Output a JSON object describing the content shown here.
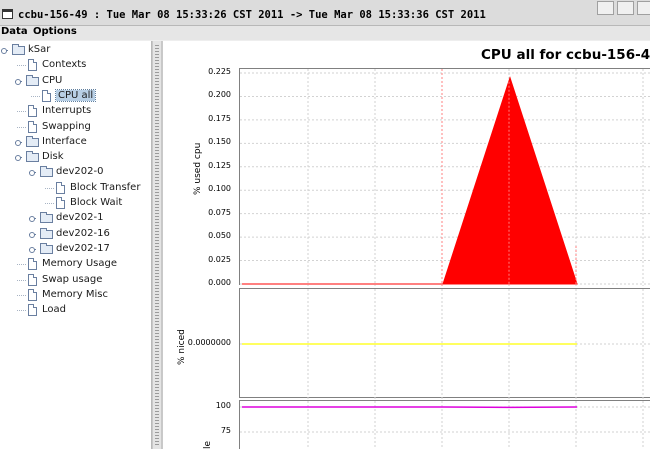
{
  "window": {
    "title": "ccbu-156-49 : Tue Mar 08 15:33:26 CST 2011 -> Tue Mar 08 15:33:36 CST 2011"
  },
  "menubar": {
    "items": [
      "Data",
      "Options"
    ]
  },
  "tree": {
    "nodes": [
      {
        "label": "kSar",
        "kind": "folder",
        "depth": 0,
        "expanded": true,
        "selected": false
      },
      {
        "label": "Contexts",
        "kind": "doc",
        "depth": 1,
        "selected": false
      },
      {
        "label": "CPU",
        "kind": "folder",
        "depth": 1,
        "expanded": true,
        "selected": false
      },
      {
        "label": "CPU all",
        "kind": "doc",
        "depth": 2,
        "selected": true
      },
      {
        "label": "Interrupts",
        "kind": "doc",
        "depth": 1,
        "selected": false
      },
      {
        "label": "Swapping",
        "kind": "doc",
        "depth": 1,
        "selected": false
      },
      {
        "label": "Interface",
        "kind": "folder",
        "depth": 1,
        "expanded": false,
        "selected": false
      },
      {
        "label": "Disk",
        "kind": "folder",
        "depth": 1,
        "expanded": true,
        "selected": false
      },
      {
        "label": "dev202-0",
        "kind": "folder",
        "depth": 2,
        "expanded": true,
        "selected": false
      },
      {
        "label": "Block Transfer",
        "kind": "doc",
        "depth": 3,
        "selected": false
      },
      {
        "label": "Block Wait",
        "kind": "doc",
        "depth": 3,
        "selected": false
      },
      {
        "label": "dev202-1",
        "kind": "folder",
        "depth": 2,
        "expanded": false,
        "selected": false
      },
      {
        "label": "dev202-16",
        "kind": "folder",
        "depth": 2,
        "expanded": false,
        "selected": false
      },
      {
        "label": "dev202-17",
        "kind": "folder",
        "depth": 2,
        "expanded": false,
        "selected": false
      },
      {
        "label": "Memory Usage",
        "kind": "doc",
        "depth": 1,
        "selected": false
      },
      {
        "label": "Swap usage",
        "kind": "doc",
        "depth": 1,
        "selected": false
      },
      {
        "label": "Memory Misc",
        "kind": "doc",
        "depth": 1,
        "selected": false
      },
      {
        "label": "Load",
        "kind": "doc",
        "depth": 1,
        "selected": false
      }
    ]
  },
  "chart": {
    "title": "CPU all for ccbu-156-4",
    "panels": [
      {
        "ylabel": "% used cpu",
        "ticks": [
          "0.225",
          "0.200",
          "0.175",
          "0.150",
          "0.125",
          "0.100",
          "0.075",
          "0.050",
          "0.025",
          "0.000"
        ],
        "fill_color": "#ff0000"
      },
      {
        "ylabel": "% niced",
        "ticks": [
          "0.0000000"
        ],
        "line_color": "#ffff00"
      },
      {
        "ylabel": "le",
        "ticks": [
          "100",
          "75"
        ],
        "line_color": "#dd00dd"
      }
    ]
  },
  "chart_data": [
    {
      "type": "area",
      "title": "CPU all for ccbu-156-4",
      "ylabel": "% used cpu",
      "x_index": [
        0,
        1,
        2,
        3,
        4,
        5
      ],
      "values": [
        0,
        0,
        0,
        0,
        0.22,
        0
      ],
      "ylim": [
        0,
        0.225
      ],
      "grid": true,
      "color": "#ff0000"
    },
    {
      "type": "line",
      "ylabel": "% niced",
      "x_index": [
        0,
        1,
        2,
        3,
        4,
        5
      ],
      "values": [
        0,
        0,
        0,
        0,
        0,
        0
      ],
      "yticks": [
        "0.0000000"
      ],
      "grid": true,
      "color": "#ffff00"
    },
    {
      "type": "line",
      "ylabel": "le",
      "x_index": [
        0,
        1,
        2,
        3,
        4,
        5
      ],
      "values": [
        100,
        100,
        100,
        100,
        99.6,
        100
      ],
      "yticks": [
        "100",
        "75"
      ],
      "grid": true,
      "color": "#dd00dd"
    }
  ]
}
